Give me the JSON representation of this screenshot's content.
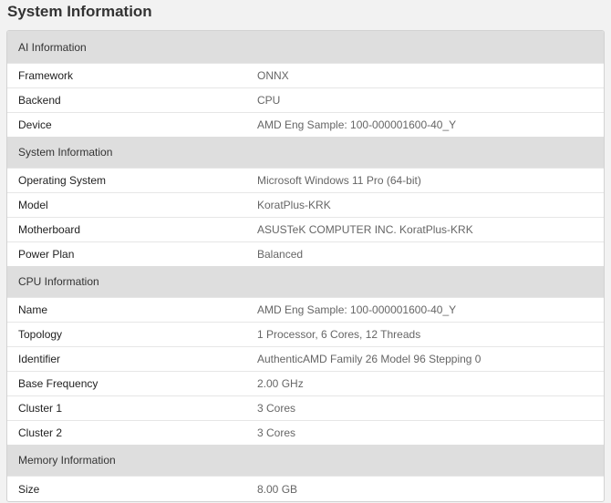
{
  "page": {
    "title": "System Information"
  },
  "sections": [
    {
      "header": "AI Information",
      "rows": [
        {
          "label": "Framework",
          "value": "ONNX"
        },
        {
          "label": "Backend",
          "value": "CPU"
        },
        {
          "label": "Device",
          "value": "AMD Eng Sample: 100-000001600-40_Y"
        }
      ]
    },
    {
      "header": "System Information",
      "rows": [
        {
          "label": "Operating System",
          "value": "Microsoft Windows 11 Pro (64-bit)"
        },
        {
          "label": "Model",
          "value": "KoratPlus-KRK"
        },
        {
          "label": "Motherboard",
          "value": "ASUSTeK COMPUTER INC. KoratPlus-KRK"
        },
        {
          "label": "Power Plan",
          "value": "Balanced"
        }
      ]
    },
    {
      "header": "CPU Information",
      "rows": [
        {
          "label": "Name",
          "value": "AMD Eng Sample: 100-000001600-40_Y"
        },
        {
          "label": "Topology",
          "value": "1 Processor, 6 Cores, 12 Threads"
        },
        {
          "label": "Identifier",
          "value": "AuthenticAMD Family 26 Model 96 Stepping 0"
        },
        {
          "label": "Base Frequency",
          "value": "2.00 GHz"
        },
        {
          "label": "Cluster 1",
          "value": "3 Cores"
        },
        {
          "label": "Cluster 2",
          "value": "3 Cores"
        }
      ]
    },
    {
      "header": "Memory Information",
      "rows": [
        {
          "label": "Size",
          "value": "8.00 GB"
        }
      ]
    }
  ]
}
